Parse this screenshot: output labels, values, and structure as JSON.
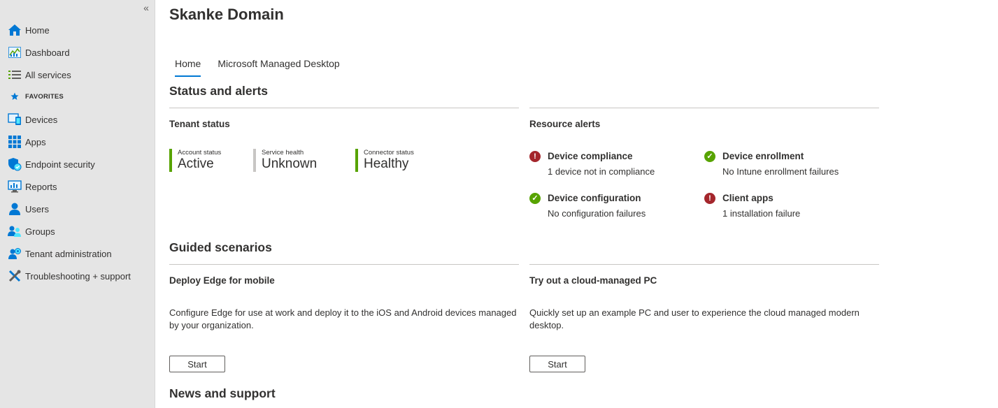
{
  "sidebar": {
    "collapse_label": "«",
    "items": [
      {
        "label": "Home",
        "icon": "home-icon"
      },
      {
        "label": "Dashboard",
        "icon": "dashboard-icon"
      },
      {
        "label": "All services",
        "icon": "list-icon"
      },
      {
        "label": "Devices",
        "icon": "devices-icon"
      },
      {
        "label": "Apps",
        "icon": "apps-icon"
      },
      {
        "label": "Endpoint security",
        "icon": "shield-icon"
      },
      {
        "label": "Reports",
        "icon": "reports-icon"
      },
      {
        "label": "Users",
        "icon": "user-icon"
      },
      {
        "label": "Groups",
        "icon": "groups-icon"
      },
      {
        "label": "Tenant administration",
        "icon": "tenant-admin-icon"
      },
      {
        "label": "Troubleshooting + support",
        "icon": "tools-icon"
      }
    ],
    "favorites_label": "FAVORITES"
  },
  "page": {
    "title": "Skanke Domain",
    "tabs": [
      {
        "label": "Home",
        "active": true
      },
      {
        "label": "Microsoft Managed Desktop",
        "active": false
      }
    ]
  },
  "status": {
    "heading": "Status and alerts",
    "tenant": {
      "heading": "Tenant status",
      "tiles": [
        {
          "label": "Account status",
          "value": "Active",
          "state": "green"
        },
        {
          "label": "Service health",
          "value": "Unknown",
          "state": "grey"
        },
        {
          "label": "Connector status",
          "value": "Healthy",
          "state": "green"
        }
      ]
    },
    "resource": {
      "heading": "Resource alerts",
      "alerts": [
        {
          "title": "Device compliance",
          "desc": "1 device not in compliance",
          "status": "error"
        },
        {
          "title": "Device enrollment",
          "desc": "No Intune enrollment failures",
          "status": "ok"
        },
        {
          "title": "Device configuration",
          "desc": "No configuration failures",
          "status": "ok"
        },
        {
          "title": "Client apps",
          "desc": "1 installation failure",
          "status": "error"
        }
      ]
    }
  },
  "guided": {
    "heading": "Guided scenarios",
    "cards": [
      {
        "title": "Deploy Edge for mobile",
        "desc": "Configure Edge for use at work and deploy it to the iOS and Android devices managed by your organization.",
        "button": "Start"
      },
      {
        "title": "Try out a cloud-managed PC",
        "desc": "Quickly set up an example PC and user to experience the cloud managed modern desktop.",
        "button": "Start"
      }
    ]
  },
  "news": {
    "heading": "News and support"
  },
  "colors": {
    "accent": "#0078d4",
    "ok": "#57a300",
    "error": "#a4262c",
    "unknown": "#c8c6c4"
  }
}
